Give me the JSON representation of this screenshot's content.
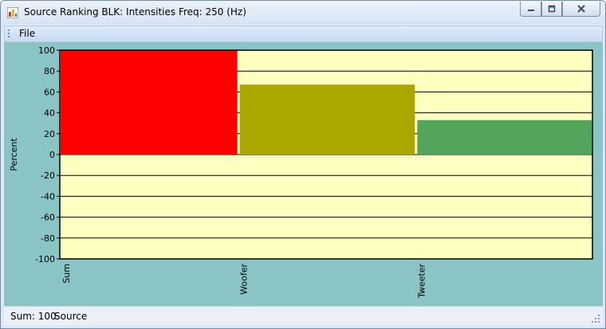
{
  "window": {
    "title": "Source Ranking BLK: Intensities Freq: 250 (Hz)"
  },
  "menu": {
    "items": [
      "File"
    ]
  },
  "status": {
    "sum_label": "Sum: 100",
    "mode_label": "Source"
  },
  "colors": {
    "plot_background": "#ffffc0",
    "outer_background": "#8bc4c4",
    "gridline": "#000000"
  },
  "icons": [
    "app-icon",
    "minimize-icon",
    "maximize-icon",
    "close-icon",
    "size-grip-icon"
  ],
  "chart_data": {
    "type": "bar",
    "categories": [
      "Sum",
      "Woofer",
      "Tweeter"
    ],
    "values": [
      100,
      67,
      33
    ],
    "bar_colors": [
      "#ff0000",
      "#aaa800",
      "#52a55a"
    ],
    "ylabel": "Percent",
    "xlabel": "",
    "ylim": [
      -100,
      100
    ],
    "yticks": [
      100,
      80,
      60,
      40,
      20,
      0,
      -20,
      -40,
      -60,
      -80,
      -100
    ],
    "grid": true
  }
}
